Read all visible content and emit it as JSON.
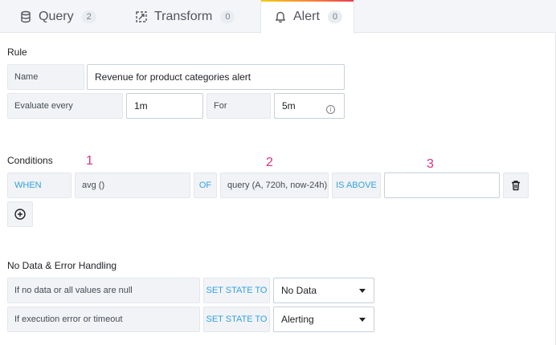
{
  "tabs": [
    {
      "label": "Query",
      "count": "2",
      "icon": "database-icon"
    },
    {
      "label": "Transform",
      "count": "0",
      "icon": "transform-icon"
    },
    {
      "label": "Alert",
      "count": "0",
      "icon": "bell-icon"
    }
  ],
  "rule": {
    "title": "Rule",
    "name_label": "Name",
    "name_value": "Revenue for product categories alert",
    "evaluate_label": "Evaluate every",
    "evaluate_value": "1m",
    "for_label": "For",
    "for_value": "5m",
    "info_glyph": "i"
  },
  "conditions": {
    "title": "Conditions",
    "when": "WHEN",
    "func": "avg ()",
    "of": "OF",
    "query": "query (A, 720h, now-24h)",
    "is_above": "IS ABOVE",
    "threshold_value": "",
    "markers": [
      "1",
      "2",
      "3"
    ]
  },
  "nodata": {
    "title": "No Data & Error Handling",
    "rows": [
      {
        "label": "If no data or all values are null",
        "action": "SET STATE TO",
        "value": "No Data"
      },
      {
        "label": "If execution error or timeout",
        "action": "SET STATE TO",
        "value": "Alerting"
      }
    ]
  },
  "colors": {
    "keyword": "#33a2e5",
    "marker": "#d8317f",
    "tab_accent": "#ff8833"
  }
}
